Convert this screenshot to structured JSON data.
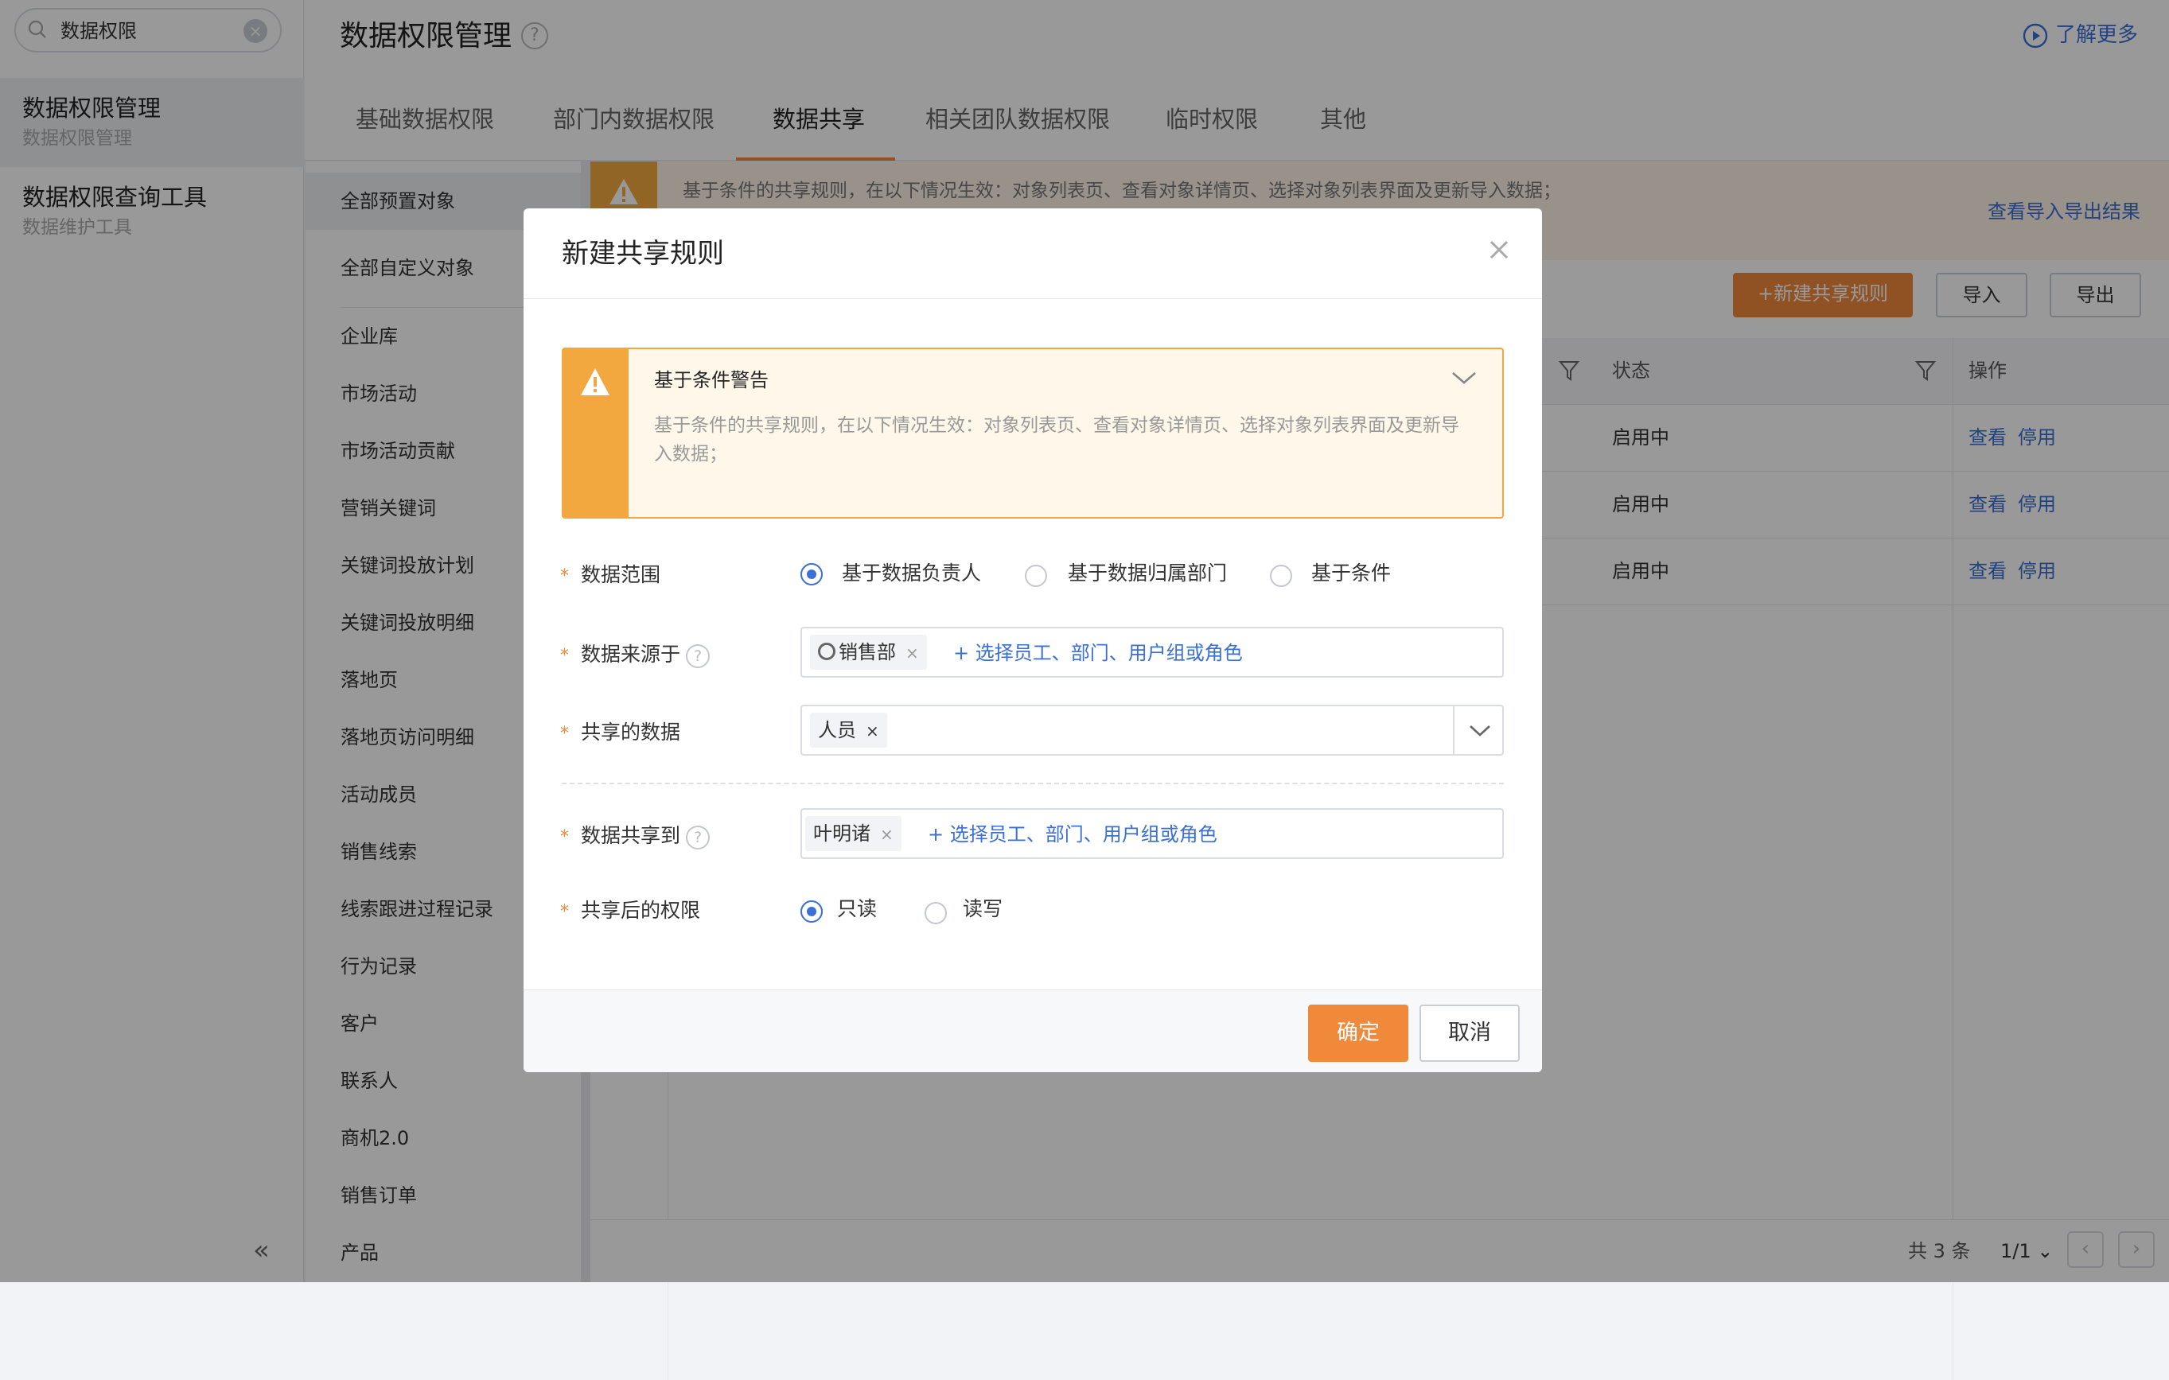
{
  "sidebar": {
    "search_value": "数据权限",
    "items": [
      {
        "title": "数据权限管理",
        "subtitle": "数据权限管理"
      },
      {
        "title": "数据权限查询工具",
        "subtitle": "数据维护工具"
      }
    ],
    "collapse_glyph": "«"
  },
  "header": {
    "title": "数据权限管理",
    "help_glyph": "?",
    "learn_more": "了解更多"
  },
  "tabs": [
    "基础数据权限",
    "部门内数据权限",
    "数据共享",
    "相关团队数据权限",
    "临时权限",
    "其他"
  ],
  "active_tab": "数据共享",
  "objects": [
    "全部预置对象",
    "全部自定义对象",
    "企业库",
    "市场活动",
    "市场活动贡献",
    "营销关键词",
    "关键词投放计划",
    "关键词投放明细",
    "落地页",
    "落地页访问明细",
    "活动成员",
    "销售线索",
    "线索跟进过程记录",
    "行为记录",
    "客户",
    "联系人",
    "商机2.0",
    "销售订单",
    "产品"
  ],
  "main": {
    "banner_text": "基于条件的共享规则，在以下情况生效：对象列表页、查看对象详情页、选择对象列表界面及更新导入数据；",
    "import_result_link": "查看导入导出结果",
    "buttons": {
      "new_rule": "+新建共享规则",
      "import": "导入",
      "export": "导出"
    },
    "columns": {
      "status": "状态",
      "ops": "操作"
    },
    "rows": [
      {
        "status": "启用中",
        "view": "查看",
        "disable": "停用"
      },
      {
        "status": "启用中",
        "view": "查看",
        "disable": "停用"
      },
      {
        "status": "启用中",
        "view": "查看",
        "disable": "停用"
      }
    ],
    "footer": {
      "total": "共 3 条",
      "page": "1/1",
      "prev": "‹",
      "next": "›"
    }
  },
  "modal": {
    "title": "新建共享规则",
    "alert": {
      "title": "基于条件警告",
      "body": "基于条件的共享规则，在以下情况生效：对象列表页、查看对象详情页、选择对象列表界面及更新导入数据；"
    },
    "required_mark": "*",
    "fields": {
      "scope": {
        "label": "数据范围",
        "options": [
          "基于数据负责人",
          "基于数据归属部门",
          "基于条件"
        ],
        "selected": "基于数据负责人"
      },
      "source": {
        "label": "数据来源于",
        "tag": "销售部",
        "add_link": "+ 选择员工、部门、用户组或角色"
      },
      "shared_data": {
        "label": "共享的数据",
        "tag": "人员"
      },
      "share_to": {
        "label": "数据共享到",
        "tag": "叶明诸",
        "add_link": "+ 选择员工、部门、用户组或角色"
      },
      "permission": {
        "label": "共享后的权限",
        "options": [
          "只读",
          "读写"
        ],
        "selected": "只读"
      }
    },
    "buttons": {
      "ok": "确定",
      "cancel": "取消"
    },
    "tag_remove_glyph": "×"
  },
  "colors": {
    "accent": "#f0893a",
    "link": "#3a6fd6",
    "warning": "#f2a83e"
  },
  "icons": [
    "search-icon",
    "clear-icon",
    "help-icon",
    "play-circle-icon",
    "warning-icon",
    "filter-icon",
    "close-icon",
    "chevron-down-icon",
    "department-icon",
    "collapse-icon"
  ]
}
